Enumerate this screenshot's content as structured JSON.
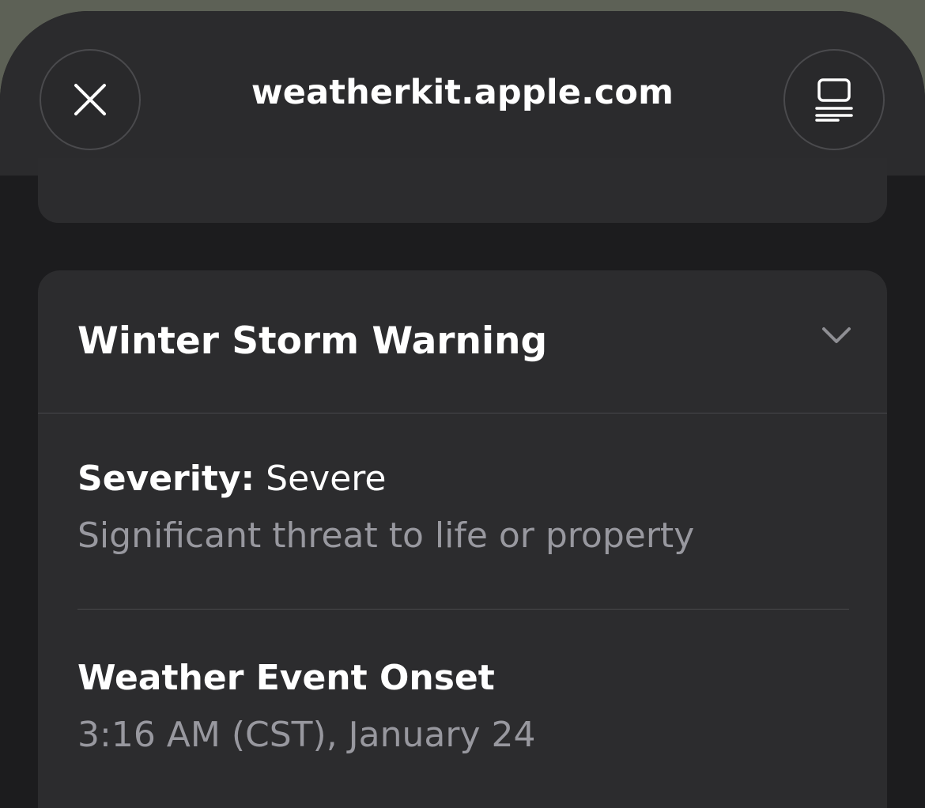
{
  "browser": {
    "url_title": "weatherkit.apple.com",
    "close_icon": "close-icon",
    "reader_icon": "reader-view-icon"
  },
  "alert": {
    "title": "Winter Storm Warning",
    "chevron_icon": "chevron-down-icon",
    "severity": {
      "label": "Severity:",
      "value": "Severe",
      "description": "Significant threat to life or property"
    },
    "onset": {
      "label": "Weather Event Onset",
      "value": "3:16 AM (CST), January 24"
    }
  },
  "colors": {
    "sheet_background": "#1c1c1e",
    "navbar_background": "#2b2b2d",
    "card_background": "#2c2c2e",
    "secondary_text": "#98989f"
  }
}
